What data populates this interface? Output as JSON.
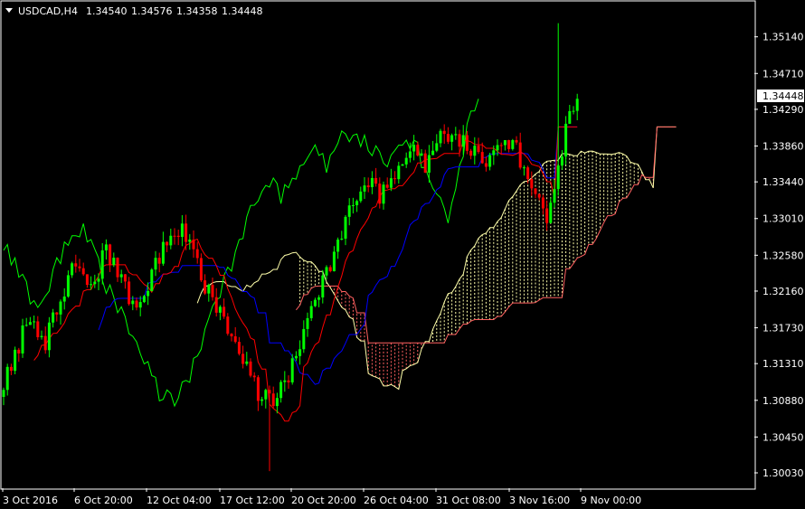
{
  "header": {
    "symbol": "USDCAD,H4",
    "open": "1.34540",
    "high": "1.34576",
    "low": "1.34358",
    "close": "1.34448"
  },
  "colors": {
    "background": "#000000",
    "frame": "#ffffff",
    "bull": "#00ff00",
    "bear": "#ff0000",
    "tenkan": "#ff0000",
    "kijun": "#0000ff",
    "chikou": "#00ff00",
    "cloud_bull": "#ffffaa",
    "cloud_bear": "#ff6060"
  },
  "chart_data": {
    "type": "candlestick",
    "indicator": "Ichimoku Kinko Hyo",
    "ylim": [
      1.2985,
      1.3555
    ],
    "yticks": [
      "1.35140",
      "1.34710",
      "1.34290",
      "1.33860",
      "1.33440",
      "1.33010",
      "1.32580",
      "1.32160",
      "1.31730",
      "1.31310",
      "1.30880",
      "1.30450",
      "1.30030"
    ],
    "xticks": [
      "3 Oct 2016",
      "6 Oct 20:00",
      "12 Oct 04:00",
      "17 Oct 12:00",
      "20 Oct 20:00",
      "26 Oct 04:00",
      "31 Oct 08:00",
      "3 Nov 16:00",
      "9 Nov 00:00"
    ],
    "current_price": "1.34448",
    "price_path": [
      [
        1.3092,
        1.3145
      ],
      [
        1.3145,
        1.3183
      ],
      [
        1.3183,
        1.3155
      ],
      [
        1.3155,
        1.3208
      ],
      [
        1.3208,
        1.3248
      ],
      [
        1.3248,
        1.3215
      ],
      [
        1.3215,
        1.3268
      ],
      [
        1.3268,
        1.323
      ],
      [
        1.323,
        1.3195
      ],
      [
        1.3195,
        1.3238
      ],
      [
        1.3238,
        1.327
      ],
      [
        1.327,
        1.3292
      ],
      [
        1.3292,
        1.3245
      ],
      [
        1.3245,
        1.3205
      ],
      [
        1.3205,
        1.3168
      ],
      [
        1.3168,
        1.3132
      ],
      [
        1.3132,
        1.3095
      ],
      [
        1.3095,
        1.3082
      ],
      [
        1.3082,
        1.3118
      ],
      [
        1.3118,
        1.3165
      ],
      [
        1.3165,
        1.3212
      ],
      [
        1.3212,
        1.3262
      ],
      [
        1.3262,
        1.3315
      ],
      [
        1.3315,
        1.3348
      ],
      [
        1.3348,
        1.3325
      ],
      [
        1.3325,
        1.3358
      ],
      [
        1.3358,
        1.338
      ],
      [
        1.338,
        1.3365
      ],
      [
        1.3365,
        1.3392
      ],
      [
        1.3392,
        1.34
      ],
      [
        1.34,
        1.3385
      ],
      [
        1.3385,
        1.337
      ],
      [
        1.337,
        1.3395
      ],
      [
        1.3395,
        1.338
      ],
      [
        1.338,
        1.3345
      ],
      [
        1.3345,
        1.3296
      ],
      [
        1.3296,
        1.3385
      ],
      [
        1.3385,
        1.3448
      ]
    ]
  }
}
